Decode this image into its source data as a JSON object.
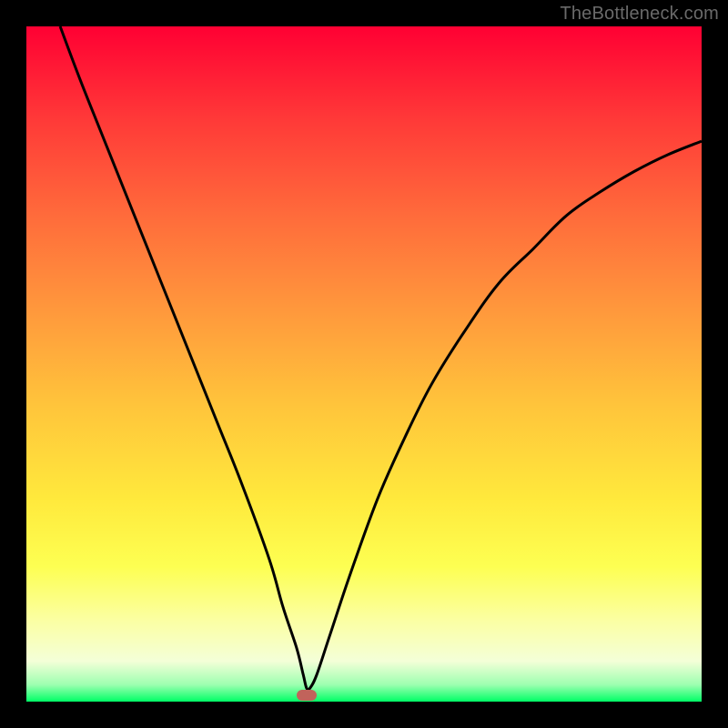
{
  "watermark": "TheBottleneck.com",
  "marker": {
    "color": "#c1635b"
  },
  "chart_data": {
    "type": "line",
    "title": "",
    "xlabel": "",
    "ylabel": "",
    "xlim": [
      0,
      100
    ],
    "ylim": [
      0,
      100
    ],
    "curve": {
      "x": [
        5,
        8,
        12,
        16,
        20,
        24,
        28,
        32,
        36,
        38,
        40,
        41,
        41.5,
        42,
        43,
        45,
        48,
        52,
        56,
        60,
        65,
        70,
        75,
        80,
        85,
        90,
        95,
        100
      ],
      "y": [
        100,
        92,
        82,
        72,
        62,
        52,
        42,
        32,
        21,
        14,
        8,
        4,
        2,
        2,
        4,
        10,
        19,
        30,
        39,
        47,
        55,
        62,
        67,
        72,
        75.5,
        78.5,
        81,
        83
      ]
    },
    "marker_point": {
      "x": 41.5,
      "y": 1
    },
    "gradient_stops": [
      {
        "pos": 0.0,
        "color": "#ff0033"
      },
      {
        "pos": 0.14,
        "color": "#ff3a38"
      },
      {
        "pos": 0.28,
        "color": "#ff6b3b"
      },
      {
        "pos": 0.42,
        "color": "#ff983c"
      },
      {
        "pos": 0.56,
        "color": "#ffc43b"
      },
      {
        "pos": 0.7,
        "color": "#ffe93c"
      },
      {
        "pos": 0.8,
        "color": "#fdff52"
      },
      {
        "pos": 0.88,
        "color": "#fbffa3"
      },
      {
        "pos": 0.94,
        "color": "#f4ffd8"
      },
      {
        "pos": 0.975,
        "color": "#9dffb0"
      },
      {
        "pos": 1.0,
        "color": "#00ff66"
      }
    ]
  }
}
